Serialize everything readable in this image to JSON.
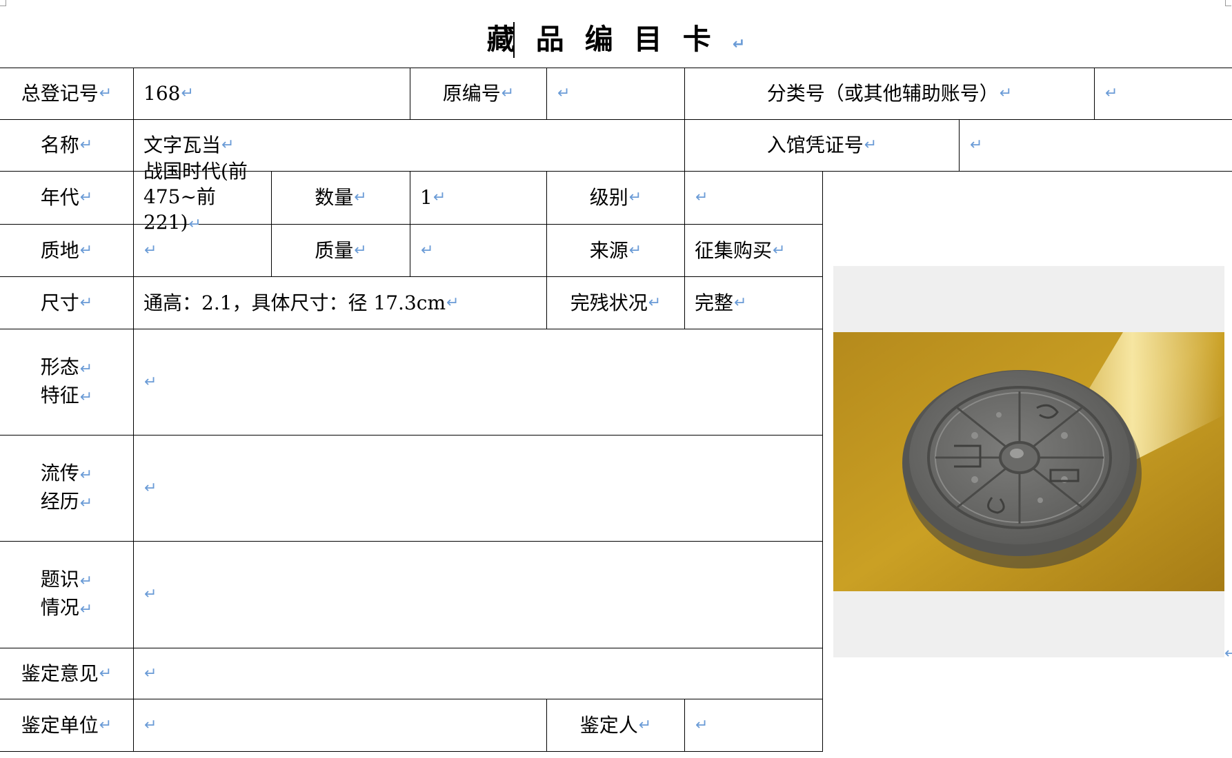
{
  "title": "藏品编目卡",
  "rows": {
    "r1": {
      "zongdengjihao_label": "总登记号",
      "zongdengjihao_value": "168",
      "yuanbianhao_label": "原编号",
      "yuanbianhao_value": "",
      "fenleihao_label": "分类号（或其他辅助账号）",
      "fenleihao_value": ""
    },
    "r2": {
      "mingcheng_label": "名称",
      "mingcheng_value": "文字瓦当",
      "ruguan_label": "入馆凭证号",
      "ruguan_value": ""
    },
    "r3": {
      "niandai_label": "年代",
      "niandai_value_line1": "战国时代(前",
      "niandai_value_line2": "475~前 221)",
      "shuliang_label": "数量",
      "shuliang_value": "1",
      "jibie_label": "级别",
      "jibie_value": ""
    },
    "r4": {
      "zhidi_label": "质地",
      "zhidi_value": "",
      "zhiliang_label": "质量",
      "zhiliang_value": "",
      "laiyuan_label": "来源",
      "laiyuan_value": "征集购买"
    },
    "r5": {
      "chicun_label": "尺寸",
      "chicun_value": "通高：2.1，具体尺寸：径 17.3cm",
      "wancan_label": "完残状况",
      "wancan_value": "完整"
    },
    "r6": {
      "label_line1": "形态",
      "label_line2": "特征",
      "value": ""
    },
    "r7": {
      "label_line1": "流传",
      "label_line2": "经历",
      "value": ""
    },
    "r8": {
      "label_line1": "题识",
      "label_line2": "情况",
      "value": ""
    },
    "r9": {
      "label": "鉴定意见",
      "value": ""
    },
    "r10": {
      "danwei_label": "鉴定单位",
      "danwei_value": "",
      "jiandingren_label": "鉴定人",
      "jiandingren_value": ""
    }
  },
  "paragraph_mark": "↵",
  "photo": {
    "subject": "circular grey clay roof tile end with inscribed characters",
    "background_color": "#c9981e",
    "tile_color": "#6e6e6c"
  }
}
